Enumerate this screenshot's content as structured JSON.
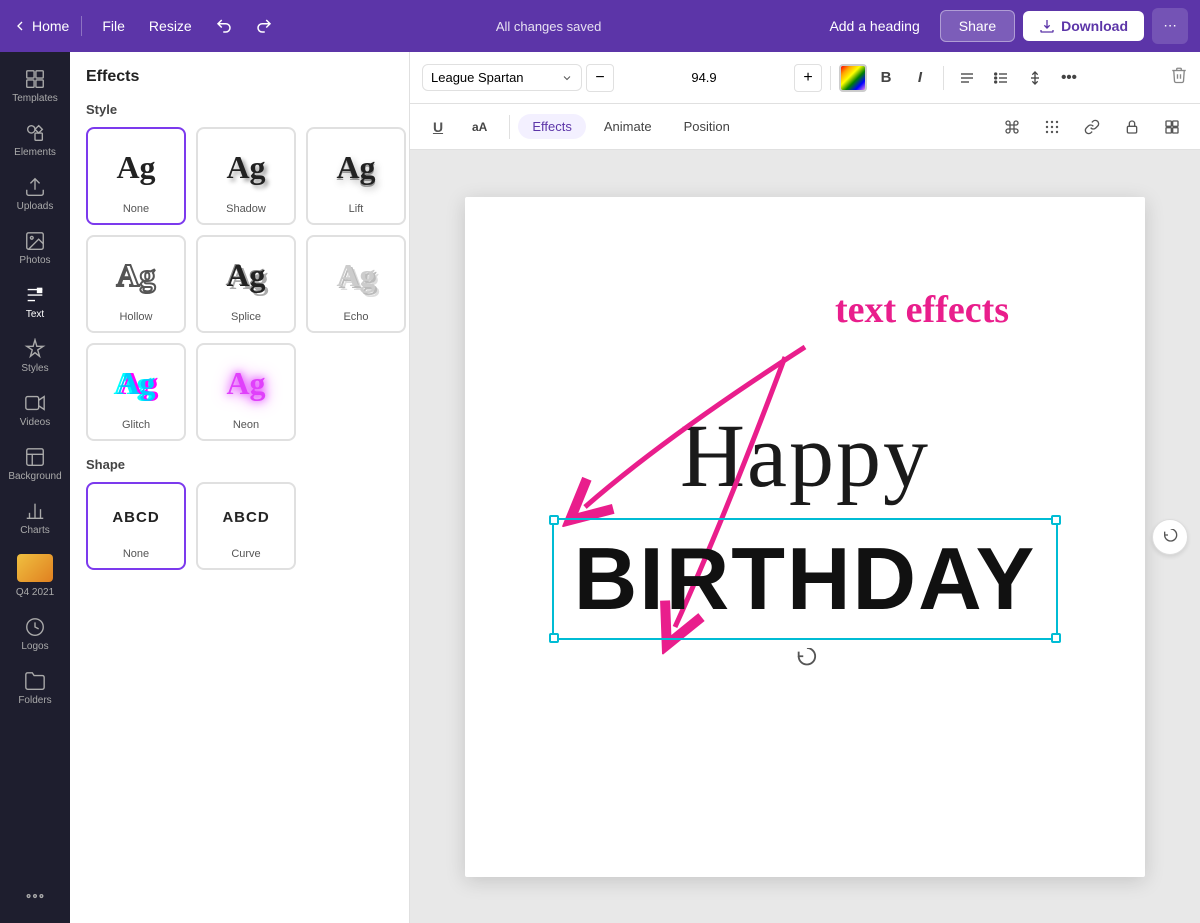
{
  "topnav": {
    "home_label": "Home",
    "file_label": "File",
    "resize_label": "Resize",
    "saved_text": "All changes saved",
    "add_heading_label": "Add a heading",
    "share_label": "Share",
    "download_label": "Download",
    "more_icon": "⋯"
  },
  "sidebar": {
    "items": [
      {
        "id": "templates",
        "label": "Templates",
        "icon": "grid"
      },
      {
        "id": "elements",
        "label": "Elements",
        "icon": "elements"
      },
      {
        "id": "uploads",
        "label": "Uploads",
        "icon": "upload"
      },
      {
        "id": "photos",
        "label": "Photos",
        "icon": "photo"
      },
      {
        "id": "text",
        "label": "Text",
        "icon": "text"
      },
      {
        "id": "styles",
        "label": "Styles",
        "icon": "styles"
      },
      {
        "id": "videos",
        "label": "Videos",
        "icon": "video"
      },
      {
        "id": "background",
        "label": "Background",
        "icon": "background"
      },
      {
        "id": "charts",
        "label": "Charts",
        "icon": "charts"
      },
      {
        "id": "q4_2021",
        "label": "Q4 2021",
        "icon": "thumbnail"
      },
      {
        "id": "logos",
        "label": "Logos",
        "icon": "logos"
      },
      {
        "id": "folders",
        "label": "Folders",
        "icon": "folders"
      }
    ]
  },
  "effects_panel": {
    "title": "Effects",
    "style_section": "Style",
    "shape_section": "Shape",
    "styles": [
      {
        "id": "none",
        "label": "None",
        "class": "preview-none"
      },
      {
        "id": "shadow",
        "label": "Shadow",
        "class": "preview-shadow"
      },
      {
        "id": "lift",
        "label": "Lift",
        "class": "preview-lift"
      },
      {
        "id": "hollow",
        "label": "Hollow",
        "class": "preview-hollow"
      },
      {
        "id": "splice",
        "label": "Splice",
        "class": "preview-splice"
      },
      {
        "id": "echo",
        "label": "Echo",
        "class": "preview-echo"
      },
      {
        "id": "glitch",
        "label": "Glitch",
        "class": "preview-glitch"
      },
      {
        "id": "neon",
        "label": "Neon",
        "class": "preview-neon"
      }
    ],
    "shapes": [
      {
        "id": "shape_none",
        "label": "None",
        "class": "preview-shape-none"
      },
      {
        "id": "curve",
        "label": "Curve",
        "class": "preview-curve"
      }
    ]
  },
  "toolbar": {
    "font_name": "League Spartan",
    "font_size": "94.9",
    "underline_label": "U",
    "aa_label": "aA",
    "effects_label": "Effects",
    "animate_label": "Animate",
    "position_label": "Position"
  },
  "canvas": {
    "happy_text": "Happy",
    "birthday_text": "BIRTHDAY",
    "annotation_text": "text effects"
  }
}
